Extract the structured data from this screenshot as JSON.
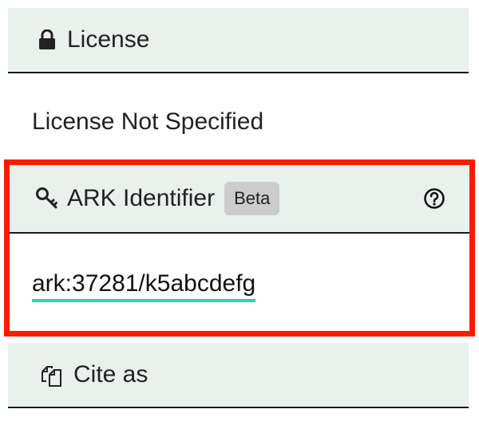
{
  "license": {
    "header": "License",
    "icon": "lock-icon",
    "value": "License Not Specified"
  },
  "ark": {
    "header": "ARK Identifier",
    "icon": "key-icon",
    "badge": "Beta",
    "help_icon": "question-circle-icon",
    "identifier": "ark:37281/k5abcdefg",
    "highlight_color": "#ff1a00",
    "link_underline_color": "#2dd4a8"
  },
  "cite": {
    "header": "Cite as",
    "icon": "copy-icon"
  }
}
